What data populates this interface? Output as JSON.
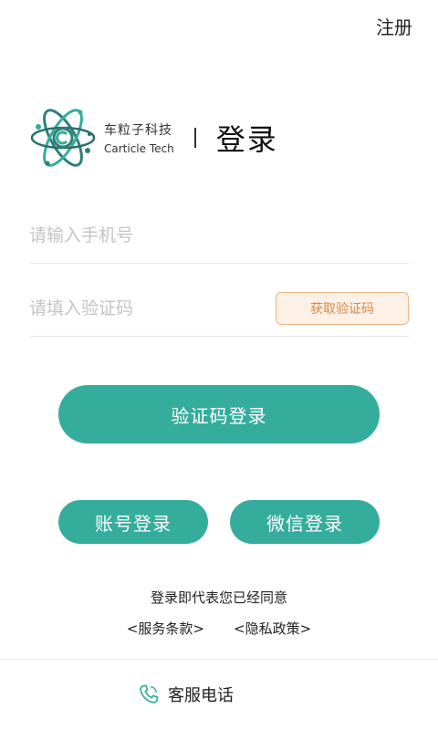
{
  "header": {
    "register_label": "注册"
  },
  "brand": {
    "name_cn": "车粒子科技",
    "name_en": "Carticle Tech",
    "page_title": "登录",
    "logo_icon": "atom-logo-icon"
  },
  "form": {
    "phone_placeholder": "请输入手机号",
    "phone_value": "",
    "code_placeholder": "请填入验证码",
    "code_value": "",
    "get_code_label": "获取验证码"
  },
  "actions": {
    "code_login_label": "验证码登录",
    "account_login_label": "账号登录",
    "wechat_login_label": "微信登录"
  },
  "agreement": {
    "text": "登录即代表您已经同意",
    "terms_label": "<服务条款>",
    "privacy_label": "<隐私政策>"
  },
  "support": {
    "label": "客服电话",
    "icon": "phone-icon"
  },
  "colors": {
    "primary": "#35ad9c",
    "code_button_border": "#e6b58a",
    "code_button_text": "#d98a4a",
    "code_button_bg": "#fdf1e6",
    "placeholder": "#c4c4c4"
  }
}
